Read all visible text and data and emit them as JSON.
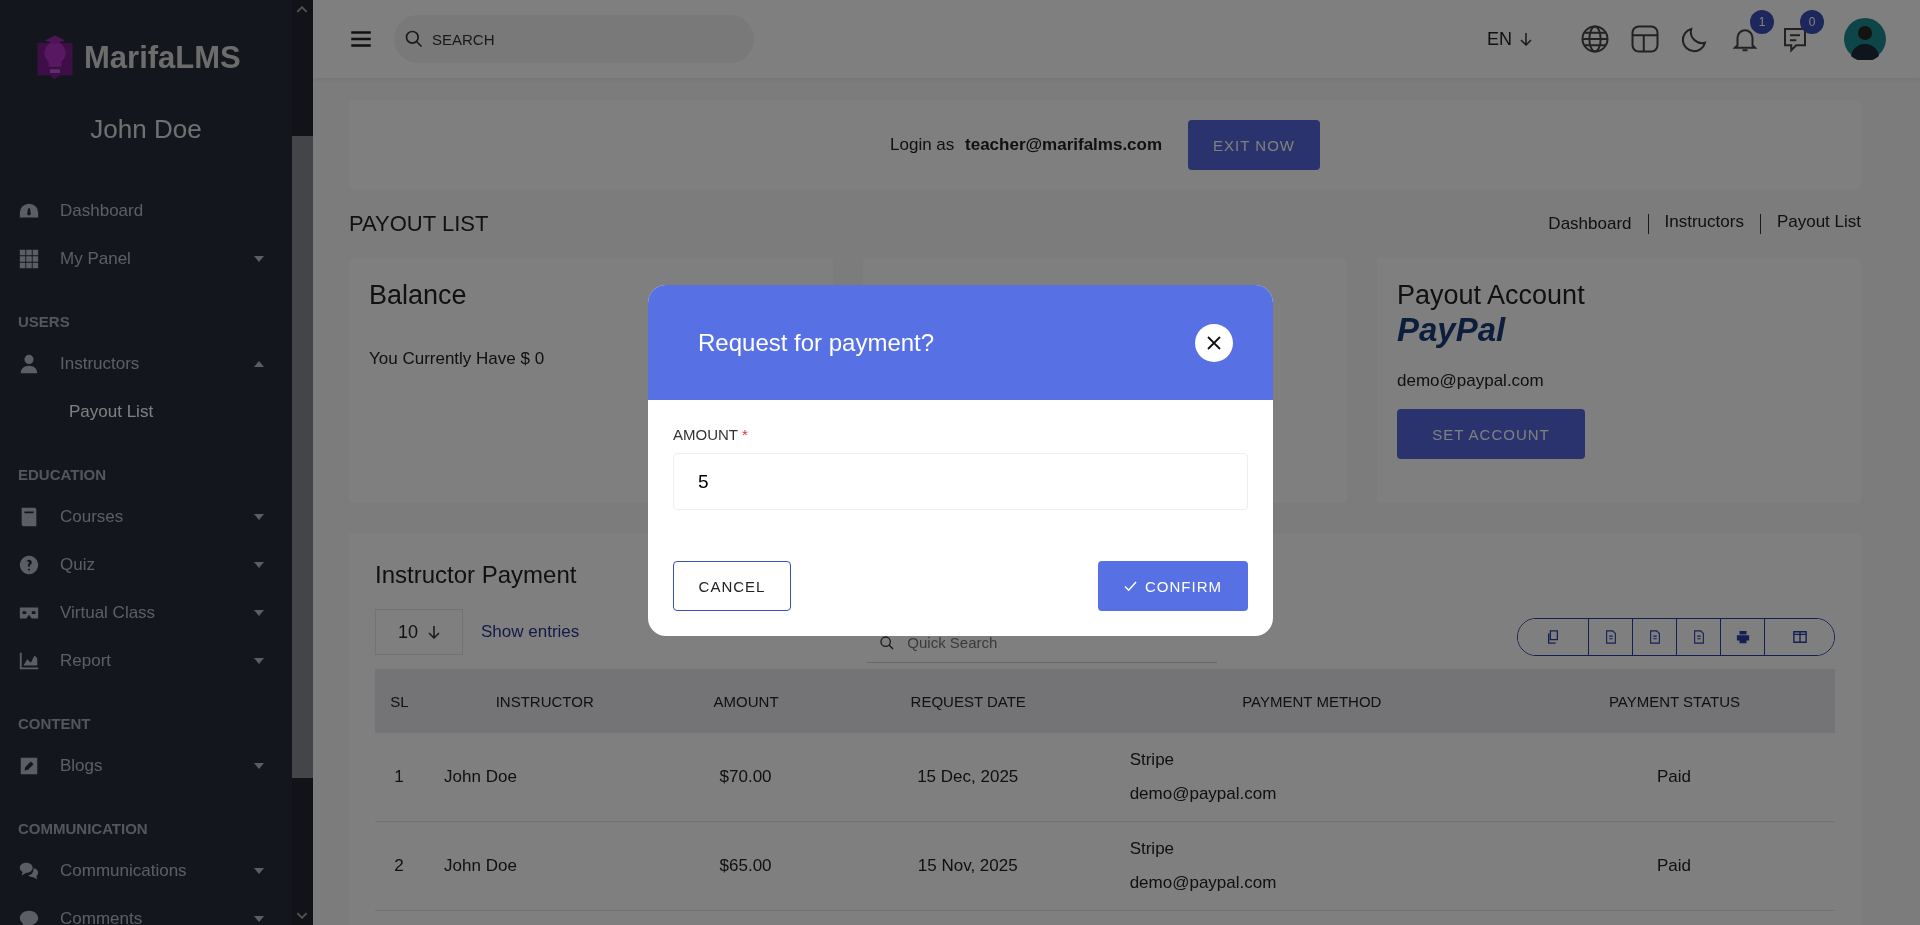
{
  "sidebar": {
    "brand": "MarifaLMS",
    "user_name": "John Doe",
    "sections": [
      {
        "items": [
          {
            "label": "Dashboard",
            "kind": "link"
          },
          {
            "label": "My Panel",
            "kind": "menu",
            "expanded": false
          }
        ]
      },
      {
        "heading": "USERS",
        "items": [
          {
            "label": "Instructors",
            "kind": "menu",
            "expanded": true,
            "children": [
              {
                "label": "Payout List",
                "selected": true
              }
            ]
          }
        ]
      },
      {
        "heading": "EDUCATION",
        "items": [
          {
            "label": "Courses",
            "kind": "menu",
            "expanded": false
          },
          {
            "label": "Quiz",
            "kind": "menu",
            "expanded": false
          },
          {
            "label": "Virtual Class",
            "kind": "menu",
            "expanded": false
          },
          {
            "label": "Report",
            "kind": "menu",
            "expanded": false
          }
        ]
      },
      {
        "heading": "CONTENT",
        "items": [
          {
            "label": "Blogs",
            "kind": "menu",
            "expanded": false
          }
        ]
      },
      {
        "heading": "COMMUNICATION",
        "items": [
          {
            "label": "Communications",
            "kind": "menu",
            "expanded": false
          },
          {
            "label": "Comments",
            "kind": "menu",
            "expanded": false
          }
        ]
      }
    ]
  },
  "topbar": {
    "search": {
      "placeholder": "SEARCH"
    },
    "language": "EN",
    "notifications_count": "1",
    "messages_count": "0"
  },
  "login_banner": {
    "prefix": "Login as",
    "email": "teacher@marifalms.com",
    "button": "EXIT NOW"
  },
  "page": {
    "title": "PAYOUT LIST",
    "breadcrumbs": [
      "Dashboard",
      "Instructors",
      "Payout List"
    ]
  },
  "balance_card": {
    "title": "Balance",
    "text": "You Currently Have $ 0"
  },
  "payout_account_card": {
    "title": "Payout Account",
    "logo": "PayPal",
    "email": "demo@paypal.com",
    "button": "SET ACCOUNT"
  },
  "payments": {
    "title": "Instructor Payment",
    "page_size": "10",
    "page_size_label": "Show entries",
    "search": {
      "placeholder": "Quick Search"
    },
    "columns": [
      "SL",
      "INSTRUCTOR",
      "AMOUNT",
      "REQUEST DATE",
      "PAYMENT METHOD",
      "PAYMENT STATUS"
    ],
    "rows": [
      {
        "sl": "1",
        "instructor": "John Doe",
        "amount": "$70.00",
        "request_date": "15 Dec, 2025",
        "method": "Stripe",
        "account": "demo@paypal.com",
        "status": "Paid"
      },
      {
        "sl": "2",
        "instructor": "John Doe",
        "amount": "$65.00",
        "request_date": "15 Nov, 2025",
        "method": "Stripe",
        "account": "demo@paypal.com",
        "status": "Paid"
      }
    ]
  },
  "modal": {
    "title": "Request for payment?",
    "field": {
      "label": "AMOUNT",
      "required_mark": "*",
      "value": "5"
    },
    "cancel": "CANCEL",
    "confirm": "CONFIRM"
  }
}
